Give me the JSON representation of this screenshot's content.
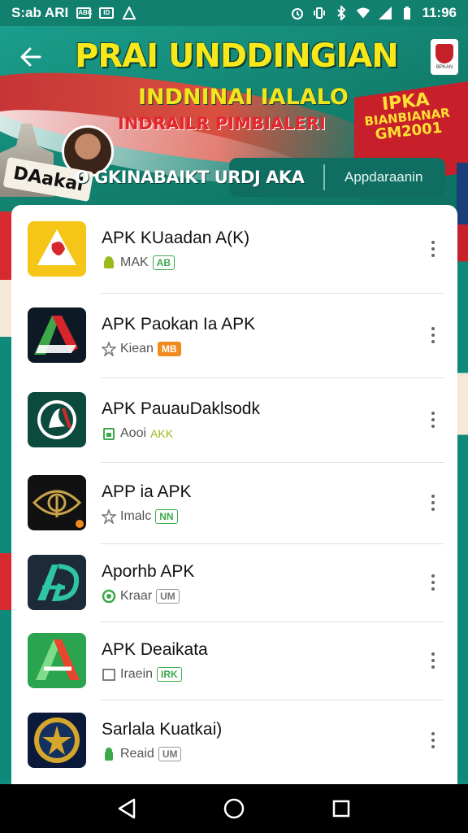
{
  "status_bar": {
    "left_text": "S:ab ARI",
    "left_badge": "ABC",
    "left_badge2": "ID",
    "time": "11:96"
  },
  "banner": {
    "title": "PRAI UNDDINGIAN",
    "subtitle1": "INDNINAI IALALO",
    "subtitle2": "INDRAILR PIMBIALERI",
    "badge_line1": "IPKA",
    "badge_line2": "BIANBIANAR",
    "badge_line3": "GM2001",
    "emblem_text": "BPKAN",
    "tilted_label": "DAakal"
  },
  "category": {
    "title": "O GKINABAIKT URDJ AKA",
    "button_label": "Appdaraanin"
  },
  "apps": [
    {
      "name": "APK KUaadan A(K)",
      "meta": "MAK",
      "tag": "AB",
      "tag_color": "#3da84a",
      "meta_icon": "android-icon",
      "icon_style": "yellow"
    },
    {
      "name": "APK Paokan Ia APK",
      "meta": "Kiean",
      "tag": "MB",
      "tag_color": "#f08a1c",
      "meta_icon": "star-icon",
      "icon_style": "dark-red-green"
    },
    {
      "name": "APK PauauDaklsodk",
      "meta": "Aooi",
      "tag": "AKK",
      "tag_color": "#9bbb1c",
      "meta_icon": "battery-icon",
      "icon_style": "dark-green"
    },
    {
      "name": "APP ia APK",
      "meta": "Imalc",
      "tag": "NN",
      "tag_color": "#3da84a",
      "meta_icon": "star-icon",
      "icon_style": "black-gold"
    },
    {
      "name": "Aporhb APK",
      "meta": "Kraar",
      "tag": "UM",
      "tag_color": "#777777",
      "meta_icon": "android-icon",
      "icon_style": "navy-teal"
    },
    {
      "name": "APK Deaikata",
      "meta": "Iraein",
      "tag": "IRK",
      "tag_color": "#3da84a",
      "meta_icon": "box-icon",
      "icon_style": "green-red"
    },
    {
      "name": "Sarlala Kuatkai)",
      "meta": "Reaid",
      "tag": "UM",
      "tag_color": "#777777",
      "meta_icon": "android-icon",
      "icon_style": "seal"
    }
  ],
  "colors": {
    "teal": "#12806f",
    "yellow": "#f7e81a",
    "red": "#d7262b"
  }
}
